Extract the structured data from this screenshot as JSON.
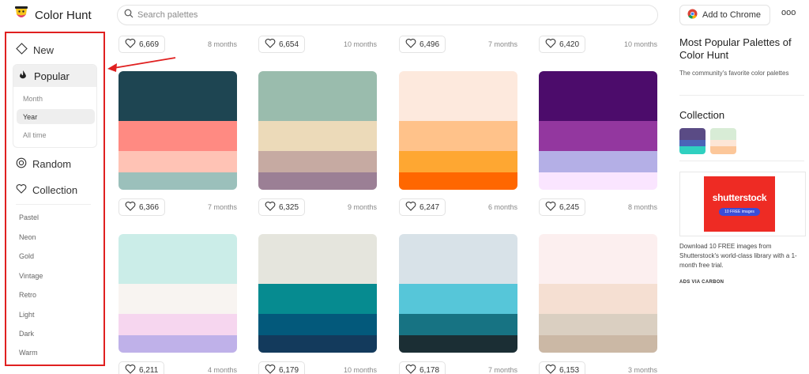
{
  "header": {
    "brand": "Color Hunt",
    "search_placeholder": "Search palettes",
    "chrome_button": "Add to Chrome",
    "more": "ooo"
  },
  "sidebar": {
    "new": "New",
    "popular": "Popular",
    "popular_sub": [
      "Month",
      "Year",
      "All time"
    ],
    "random": "Random",
    "collection": "Collection",
    "tags": [
      "Pastel",
      "Neon",
      "Gold",
      "Vintage",
      "Retro",
      "Light",
      "Dark",
      "Warm"
    ]
  },
  "palettes": [
    {
      "likes": "6,366",
      "age": "7 months",
      "colors": [
        "#1e4552",
        "#ff8a82",
        "#ffc3b5",
        "#9bc0bb"
      ]
    },
    {
      "likes": "6,325",
      "age": "9 months",
      "colors": [
        "#9abcad",
        "#ecdab9",
        "#c6aaa2",
        "#9b7f95"
      ]
    },
    {
      "likes": "6,247",
      "age": "6 months",
      "colors": [
        "#fde9dd",
        "#ffc28a",
        "#fea732",
        "#ff6700"
      ]
    },
    {
      "likes": "6,245",
      "age": "8 months",
      "colors": [
        "#4c0c6b",
        "#93379f",
        "#b4afe6",
        "#fae5ff"
      ]
    },
    {
      "likes": "6,211",
      "age": "4 months",
      "colors": [
        "#cbede8",
        "#f8f4f1",
        "#f6d6ef",
        "#bfb1e9"
      ]
    },
    {
      "likes": "6,179",
      "age": "10 months",
      "colors": [
        "#e5e5dd",
        "#068b90",
        "#03597b",
        "#133a5c"
      ]
    },
    {
      "likes": "6,178",
      "age": "7 months",
      "colors": [
        "#d8e2e8",
        "#56c6d9",
        "#177383",
        "#1b2e34"
      ]
    },
    {
      "likes": "6,153",
      "age": "3 months",
      "colors": [
        "#fcefef",
        "#f5dfd2",
        "#dacfc1",
        "#cbb8a5"
      ]
    }
  ],
  "top_row": [
    {
      "likes": "6,669",
      "age": "8 months"
    },
    {
      "likes": "6,654",
      "age": "10 months"
    },
    {
      "likes": "6,496",
      "age": "7 months"
    },
    {
      "likes": "6,420",
      "age": "10 months"
    }
  ],
  "right_panel": {
    "title": "Most Popular Palettes of Color Hunt",
    "description": "The community's favorite color palettes",
    "collection": "Collection",
    "collection_items": [
      [
        "#5a4b85",
        "#4a64b8",
        "#2fd0c0"
      ],
      [
        "#d8ecd6",
        "#fde6d6",
        "#fcc79a"
      ]
    ],
    "ad_logo": "shutterstock",
    "ad_pill": "10 FREE images",
    "ad_text": "Download 10 FREE images from Shutterstock's world-class library with a 1-month free trial.",
    "ad_via": "ADS VIA CARBON"
  },
  "colors": {
    "highlight": "#e02020",
    "accent": "#e02020"
  }
}
